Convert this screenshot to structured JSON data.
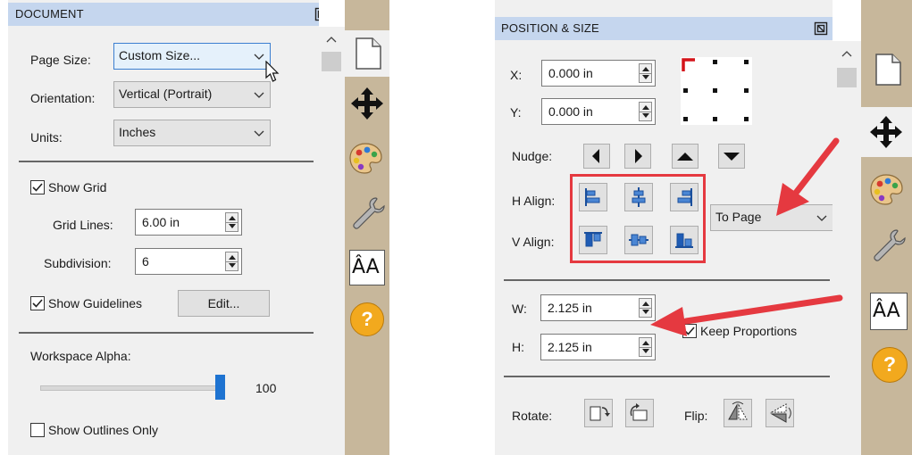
{
  "document_panel": {
    "title": "DOCUMENT",
    "page_size_label": "Page Size:",
    "page_size_value": "Custom Size...",
    "orientation_label": "Orientation:",
    "orientation_value": "Vertical (Portrait)",
    "units_label": "Units:",
    "units_value": "Inches",
    "show_grid_label": "Show Grid",
    "show_grid_checked": true,
    "grid_lines_label": "Grid Lines:",
    "grid_lines_value": "6.00 in",
    "subdivision_label": "Subdivision:",
    "subdivision_value": "6",
    "show_guidelines_label": "Show Guidelines",
    "show_guidelines_checked": true,
    "edit_button": "Edit...",
    "workspace_alpha_label": "Workspace Alpha:",
    "workspace_alpha_value": "100",
    "workspace_alpha_level": 1.0,
    "show_outlines_label": "Show Outlines Only",
    "show_outlines_checked": false
  },
  "position_panel": {
    "title": "POSITION & SIZE",
    "x_label": "X:",
    "x_value": "0.000 in",
    "y_label": "Y:",
    "y_value": "0.000 in",
    "nudge_label": "Nudge:",
    "h_align_label": "H Align:",
    "v_align_label": "V Align:",
    "align_to_value": "To Page",
    "w_label": "W:",
    "w_value": "2.125 in",
    "h_label": "H:",
    "h_value": "2.125 in",
    "keep_proportions_label": "Keep Proportions",
    "keep_proportions_checked": true,
    "rotate_label": "Rotate:",
    "flip_label": "Flip:"
  },
  "sidebar_tabs": {
    "font_tab_label": "ÂA",
    "help_tab_label": "?"
  },
  "colors": {
    "header_bg": "#c5d6ee",
    "panel_bg": "#f0f0f0",
    "sidebar_bg": "#c7b79b",
    "slider_thumb": "#1e73d1",
    "highlight_box": "#e53940",
    "annotation_arrow": "#e53940"
  }
}
